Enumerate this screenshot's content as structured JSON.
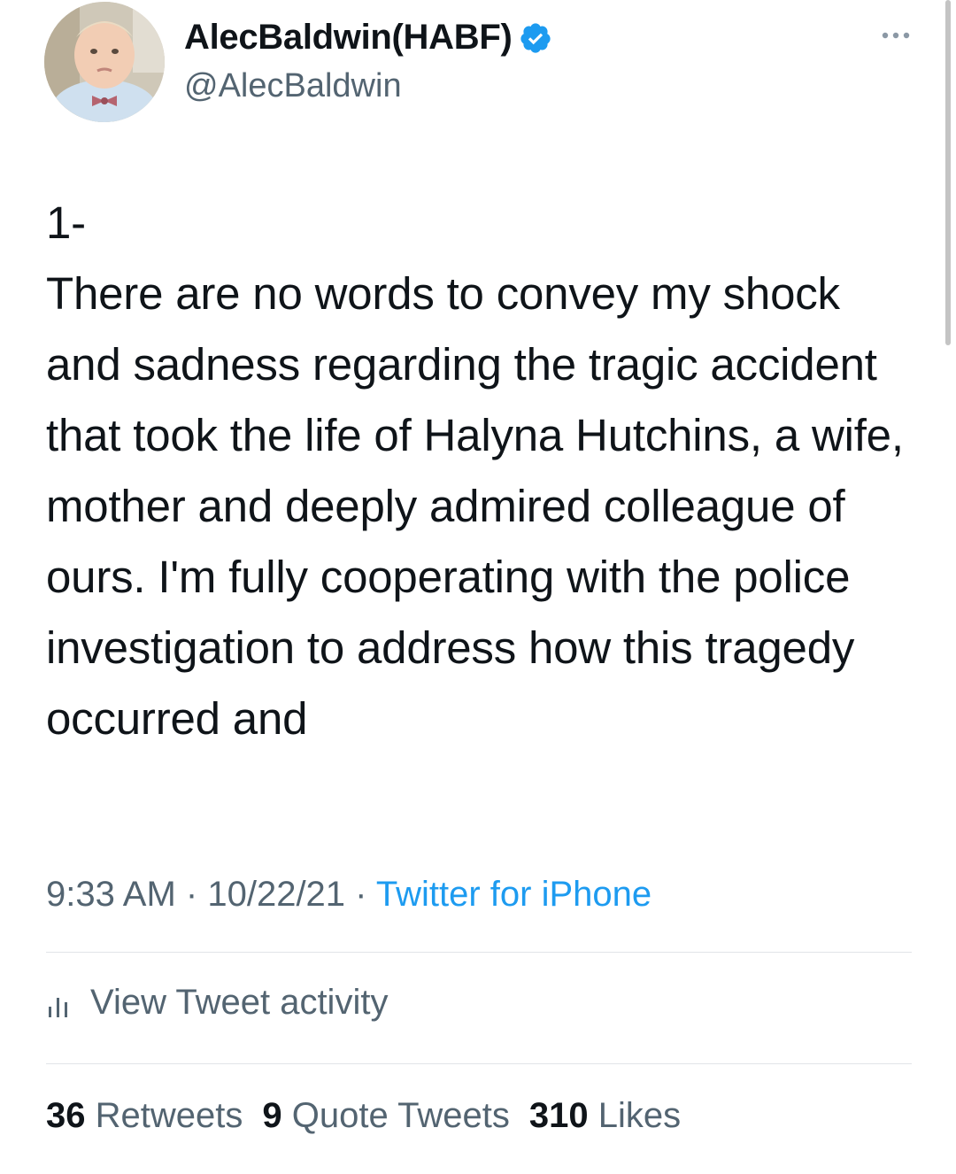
{
  "author": {
    "display_name": "AlecBaldwin(HABF)",
    "handle": "@AlecBaldwin",
    "verified": true,
    "avatar_icon": "profile-photo-toddler-bowtie"
  },
  "header": {
    "more_icon": "more-options-icon"
  },
  "tweet": {
    "text": "1-\nThere are no words to convey my shock and sadness regarding the tragic accident that took the life of Halyna Hutchins, a wife, mother and deeply admired colleague of ours. I'm fully cooperating with the police investigation to address how this tragedy occurred and"
  },
  "meta": {
    "time": "9:33 AM",
    "separator": "·",
    "date": "10/22/21",
    "source": "Twitter for iPhone"
  },
  "activity": {
    "label": "View Tweet activity",
    "icon": "bar-chart-icon"
  },
  "stats": {
    "retweets_count": "36",
    "retweets_label": "Retweets",
    "quotes_count": "9",
    "quotes_label": "Quote Tweets",
    "likes_count": "310",
    "likes_label": "Likes"
  },
  "colors": {
    "accent": "#1d9bf0",
    "text_primary": "#0f1419",
    "text_secondary": "#536471",
    "divider": "#e1e4e8"
  }
}
